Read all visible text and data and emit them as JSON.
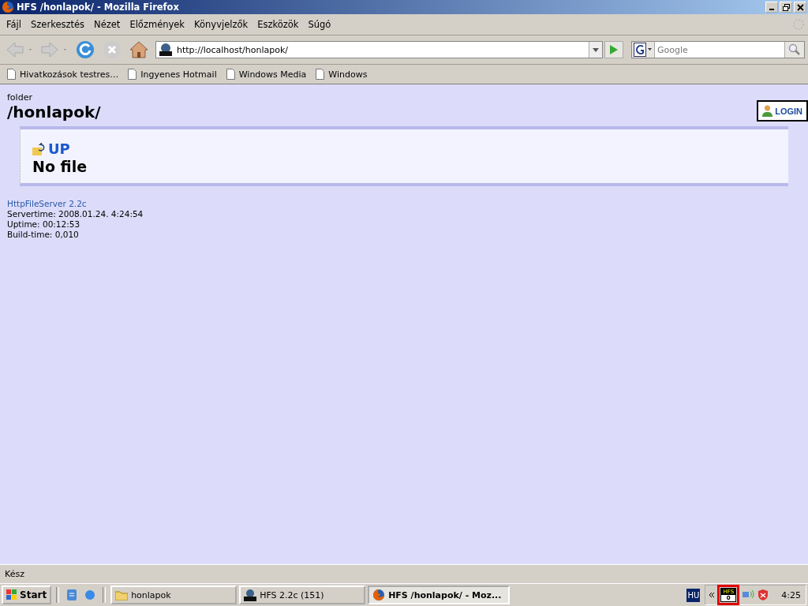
{
  "window": {
    "title": "HFS /honlapok/ - Mozilla Firefox"
  },
  "menu": [
    "Fájl",
    "Szerkesztés",
    "Nézet",
    "Előzmények",
    "Könyvjelzők",
    "Eszközök",
    "Súgó"
  ],
  "toolbar": {
    "url": "http://localhost/honlapok/",
    "search_placeholder": "Google"
  },
  "bookmarks": [
    "Hivatkozások testres…",
    "Ingyenes Hotmail",
    "Windows Media",
    "Windows"
  ],
  "page": {
    "label": "folder",
    "path": "/honlapok/",
    "login": "LOGIN",
    "up": "UP",
    "empty": "No file",
    "footer_link": "HttpFileServer 2.2c",
    "footer_lines": [
      "Servertime: 2008.01.24. 4:24:54",
      "Uptime: 00:12:53",
      "Build-time: 0,010"
    ]
  },
  "status_bar": "Kész",
  "taskbar": {
    "start": "Start",
    "buttons": [
      {
        "label": "honlapok",
        "kind": "folder",
        "selected": false
      },
      {
        "label": "HFS 2.2c (151)",
        "kind": "hfs",
        "selected": false
      },
      {
        "label": "HFS /honlapok/ - Moz...",
        "kind": "firefox",
        "selected": true
      }
    ],
    "language": "HU",
    "tray_hfs": {
      "label": "HFS",
      "count": "0",
      "highlighted": true
    },
    "clock": "4:25"
  }
}
